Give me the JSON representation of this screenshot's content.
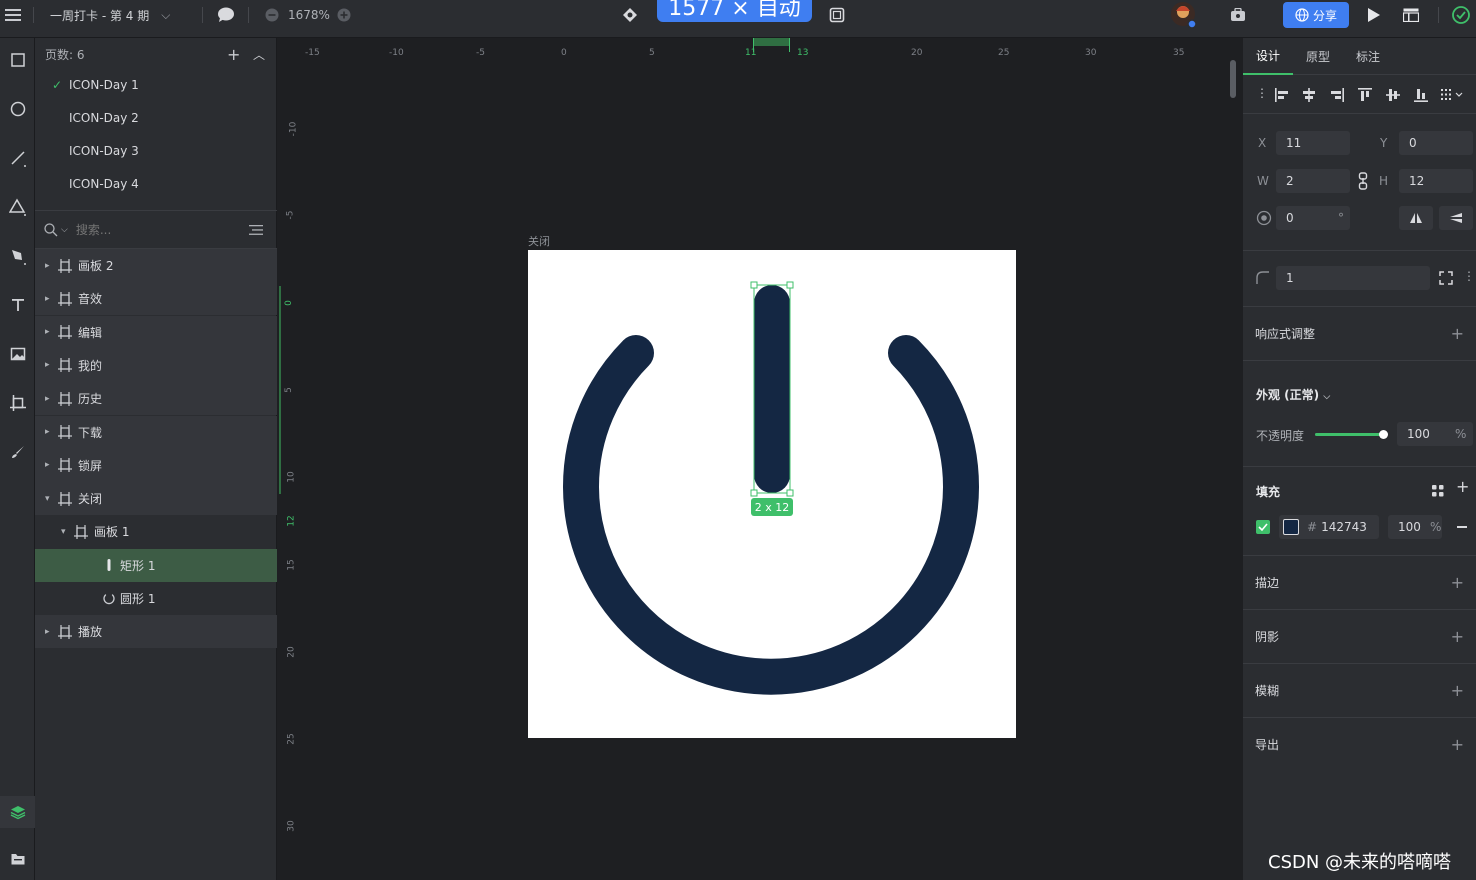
{
  "topbar": {
    "project": "一周打卡 - 第 4 期",
    "zoom": "1678%",
    "badge_text": "1577 × 自动",
    "share_label": "分享"
  },
  "pages": {
    "header": "页数: 6",
    "items": [
      "ICON-Day 1",
      "ICON-Day 2",
      "ICON-Day 3",
      "ICON-Day 4"
    ]
  },
  "search": {
    "placeholder": "搜索..."
  },
  "layers": [
    {
      "label": "画板 2",
      "indent": 0,
      "kind": "board",
      "expanded": false
    },
    {
      "label": "音效",
      "indent": 0,
      "kind": "board",
      "expanded": false
    },
    {
      "label": "编辑",
      "indent": 0,
      "kind": "board",
      "expanded": false
    },
    {
      "label": "我的",
      "indent": 0,
      "kind": "board",
      "expanded": false
    },
    {
      "label": "历史",
      "indent": 0,
      "kind": "board",
      "expanded": false
    },
    {
      "label": "下载",
      "indent": 0,
      "kind": "board",
      "expanded": false
    },
    {
      "label": "锁屏",
      "indent": 0,
      "kind": "board",
      "expanded": false
    },
    {
      "label": "关闭",
      "indent": 0,
      "kind": "board",
      "expanded": true
    },
    {
      "label": "画板 1",
      "indent": 1,
      "kind": "board",
      "expanded": true
    },
    {
      "label": "矩形 1",
      "indent": 2,
      "kind": "rect",
      "selected": true
    },
    {
      "label": "圆形 1",
      "indent": 2,
      "kind": "circle"
    },
    {
      "label": "播放",
      "indent": 0,
      "kind": "board",
      "expanded": false
    }
  ],
  "canvas": {
    "artboard_label": "关闭",
    "size_label": "2 x 12",
    "icon_color": "#142743",
    "hruler": [
      "-15",
      "-10",
      "-5",
      "0",
      "5",
      "11",
      "13",
      "20",
      "25",
      "30",
      "35"
    ],
    "vruler": [
      "-10",
      "-5",
      "0",
      "5",
      "10",
      "12",
      "15",
      "20",
      "25",
      "30"
    ]
  },
  "inspector": {
    "tabs": [
      "设计",
      "原型",
      "标注"
    ],
    "x_label": "X",
    "x": "11",
    "y_label": "Y",
    "y": "0",
    "w_label": "W",
    "w": "2",
    "h_label": "H",
    "h": "12",
    "rotation": "0",
    "rotation_unit": "°",
    "radius": "1",
    "responsive": "响应式调整",
    "appearance": "外观 (正常)",
    "opacity_label": "不透明度",
    "opacity": "100",
    "opacity_unit": "%",
    "opacity_level": 1.0,
    "fill_title": "填充",
    "fill_hex_prefix": "#",
    "fill_hex": "142743",
    "fill_opacity": "100",
    "fill_opacity_unit": "%",
    "stroke": "描边",
    "shadow": "阴影",
    "blur": "模糊",
    "export": "导出"
  },
  "watermark": "CSDN @未来的嗒嘀嗒"
}
